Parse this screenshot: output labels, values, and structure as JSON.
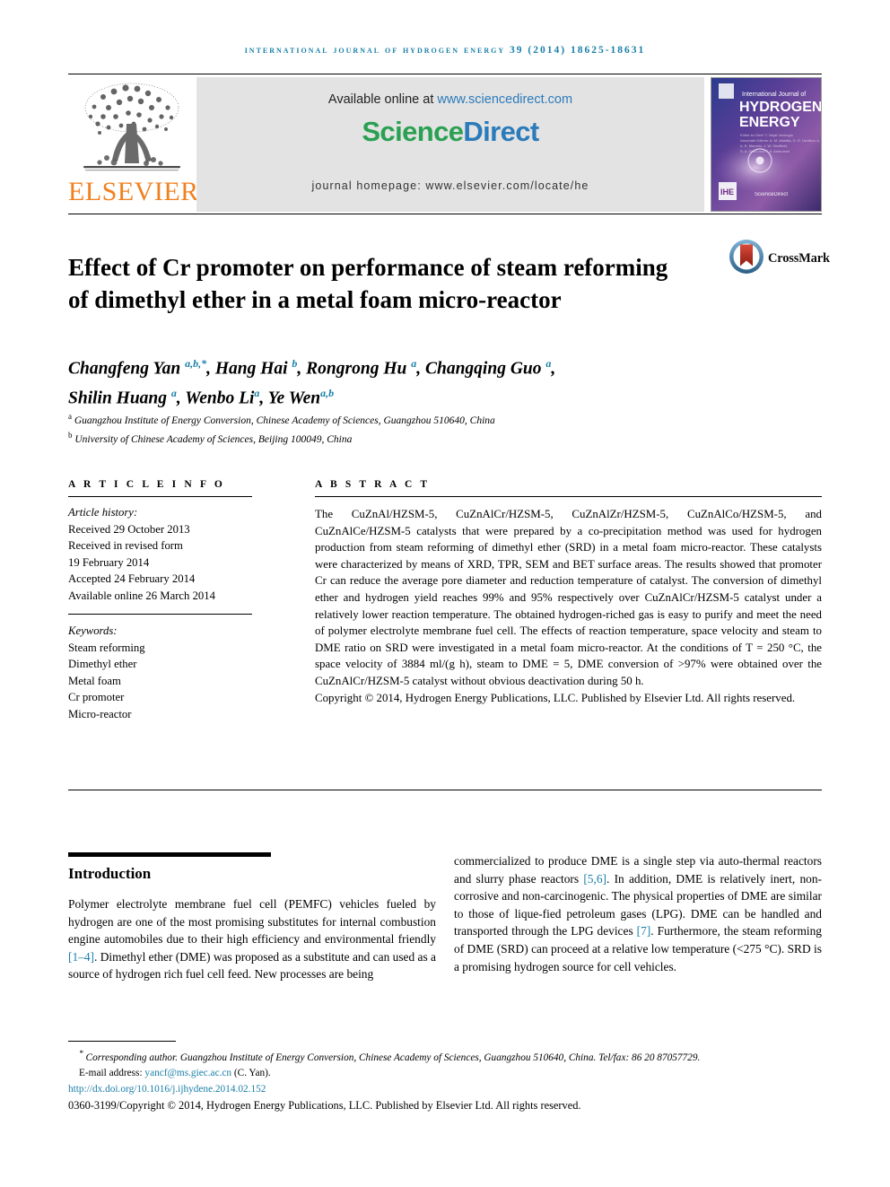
{
  "running_head": "International Journal of Hydrogen Energy 39 (2014) 18625-18631",
  "header": {
    "publisher_name": "ELSEVIER",
    "available_prefix": "Available online at ",
    "available_url": "www.sciencedirect.com",
    "sciencedirect_part1": "Science",
    "sciencedirect_part2": "Direct",
    "journal_homepage": "journal homepage: www.elsevier.com/locate/he",
    "cover": {
      "line1": "International Journal of",
      "line2": "HYDROGEN",
      "line3": "ENERGY",
      "badge": "IJHE",
      "footer_mark": "ScienceDirect"
    }
  },
  "article": {
    "title": "Effect of Cr promoter on performance of steam reforming of dimethyl ether in a metal foam micro-reactor",
    "crossmark_label": "CrossMark",
    "authors_line1_html": "Changfeng Yan <sup>a,b,*</sup>, Hang Hai <sup>b</sup>, Rongrong Hu <sup>a</sup>, Changqing Guo <sup>a</sup>,",
    "authors_line2_html": "Shilin Huang <sup>a</sup>, Wenbo Li<sup>a</sup>, Ye Wen<sup>a,b</sup>",
    "affiliation_a": "Guangzhou Institute of Energy Conversion, Chinese Academy of Sciences, Guangzhou 510640, China",
    "affiliation_b": "University of Chinese Academy of Sciences, Beijing 100049, China",
    "affiliation_a_marker": "a",
    "affiliation_b_marker": "b"
  },
  "article_info": {
    "heading": "A R T I C L E    I N F O",
    "history_label": "Article history:",
    "history": [
      "Received 29 October 2013",
      "Received in revised form",
      "19 February 2014",
      "Accepted 24 February 2014",
      "Available online 26 March 2014"
    ],
    "keywords_label": "Keywords:",
    "keywords": [
      "Steam reforming",
      "Dimethyl ether",
      "Metal foam",
      "Cr promoter",
      "Micro-reactor"
    ]
  },
  "abstract": {
    "heading": "A B S T R A C T",
    "body": "The CuZnAl/HZSM-5, CuZnAlCr/HZSM-5, CuZnAlZr/HZSM-5, CuZnAlCo/HZSM-5, and CuZnAlCe/HZSM-5 catalysts that were prepared by a co-precipitation method was used for hydrogen production from steam reforming of dimethyl ether (SRD) in a metal foam micro-reactor. These catalysts were characterized by means of XRD, TPR, SEM and BET surface areas. The results showed that promoter Cr can reduce the average pore diameter and reduction temperature of catalyst. The conversion of dimethyl ether and hydrogen yield reaches 99% and 95% respectively over CuZnAlCr/HZSM-5 catalyst under a relatively lower reaction temperature. The obtained hydrogen-riched gas is easy to purify and meet the need of polymer electrolyte membrane fuel cell. The effects of reaction temperature, space velocity and steam to DME ratio on SRD were investigated in a metal foam micro-reactor. At the conditions of T = 250 °C, the space velocity of 3884 ml/(g h), steam to DME = 5, DME conversion of >97% were obtained over the CuZnAlCr/HZSM-5 catalyst without obvious deactivation during 50 h.",
    "copyright": "Copyright © 2014, Hydrogen Energy Publications, LLC. Published by Elsevier Ltd. All rights reserved."
  },
  "introduction": {
    "heading": "Introduction",
    "left_para_html": "Polymer electrolyte membrane fuel cell (PEMFC) vehicles fueled by hydrogen are one of the most promising substitutes for internal combustion engine automobiles due to their high efficiency and environmental friendly <span class=\"ref\">[1&ndash;4]</span>. Dimethyl ether (DME) was proposed as a substitute and can used as a source of hydrogen rich fuel cell feed. New processes are being",
    "right_para_html": "commercialized to produce DME is a single step via auto-thermal reactors and slurry phase reactors <span class=\"ref\">[5,6]</span>. In addition, DME is relatively inert, non-corrosive and non-carcinogenic. The physical properties of DME are similar to those of lique-fied petroleum gases (LPG). DME can be handled and transported through the LPG devices <span class=\"ref\">[7]</span>. Furthermore, the steam reforming of DME (SRD) can proceed at a relative low temperature (&lt;275 &deg;C). SRD is a promising hydrogen source for cell vehicles."
  },
  "footer": {
    "corresponding_marker": "*",
    "corresponding_author": "Corresponding author. Guangzhou Institute of Energy Conversion, Chinese Academy of Sciences, Guangzhou 510640, China. Tel/fax: 86 20 87057729.",
    "email_label": "E-mail address:",
    "email": "yancf@ms.giec.ac.cn",
    "email_owner": "(C. Yan).",
    "doi": "http://dx.doi.org/10.1016/j.ijhydene.2014.02.152",
    "issn_line": "0360-3199/Copyright © 2014, Hydrogen Energy Publications, LLC. Published by Elsevier Ltd. All rights reserved."
  },
  "colors": {
    "link": "#1a7fa8",
    "elsevier_orange": "#F08020",
    "sciencedirect_green": "#2aa052",
    "sciencedirect_blue": "#2b7bba",
    "band_gray": "#e3e3e3"
  }
}
